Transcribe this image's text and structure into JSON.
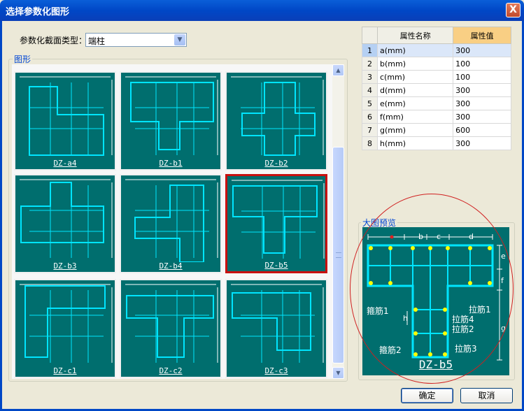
{
  "dialog": {
    "title": "选择参数化图形",
    "close_glyph": "X"
  },
  "section_type": {
    "label": "参数化截面类型：",
    "value": "端柱",
    "arrow": "▼"
  },
  "shapes_group": {
    "label": "图形"
  },
  "thumbnails": [
    {
      "name": "DZ-a4"
    },
    {
      "name": "DZ-b1"
    },
    {
      "name": "DZ-b2"
    },
    {
      "name": "DZ-b3"
    },
    {
      "name": "DZ-b4"
    },
    {
      "name": "DZ-b5"
    },
    {
      "name": "DZ-c1"
    },
    {
      "name": "DZ-c2"
    },
    {
      "name": "DZ-c3"
    }
  ],
  "selected_thumbnail": "DZ-b5",
  "properties": {
    "headers": [
      "属性名称",
      "属性值"
    ],
    "rows": [
      {
        "idx": "1",
        "name": "a(mm)",
        "value": "300"
      },
      {
        "idx": "2",
        "name": "b(mm)",
        "value": "100"
      },
      {
        "idx": "3",
        "name": "c(mm)",
        "value": "100"
      },
      {
        "idx": "4",
        "name": "d(mm)",
        "value": "300"
      },
      {
        "idx": "5",
        "name": "e(mm)",
        "value": "300"
      },
      {
        "idx": "6",
        "name": "f(mm)",
        "value": "300"
      },
      {
        "idx": "7",
        "name": "g(mm)",
        "value": "600"
      },
      {
        "idx": "8",
        "name": "h(mm)",
        "value": "300"
      }
    ]
  },
  "preview": {
    "label": "大图预览",
    "name": "DZ-b5",
    "labels": {
      "stirrup1": "箍筋1",
      "stirrup2": "箍筋2",
      "tie1": "拉筋1",
      "tie2": "拉筋2",
      "tie3": "拉筋3",
      "tie4": "拉筋4"
    },
    "dims": {
      "a": "a",
      "b": "b",
      "c": "c",
      "d": "d",
      "e": "e",
      "f": "f",
      "g": "g",
      "h": "h"
    }
  },
  "buttons": {
    "ok": "确定",
    "cancel": "取消"
  },
  "colors": {
    "accent": "#0047c6",
    "figure_bg": "#006e6e",
    "rebar": "#00e5ff",
    "selected": "#c8100f",
    "dot": "#ffff00"
  }
}
